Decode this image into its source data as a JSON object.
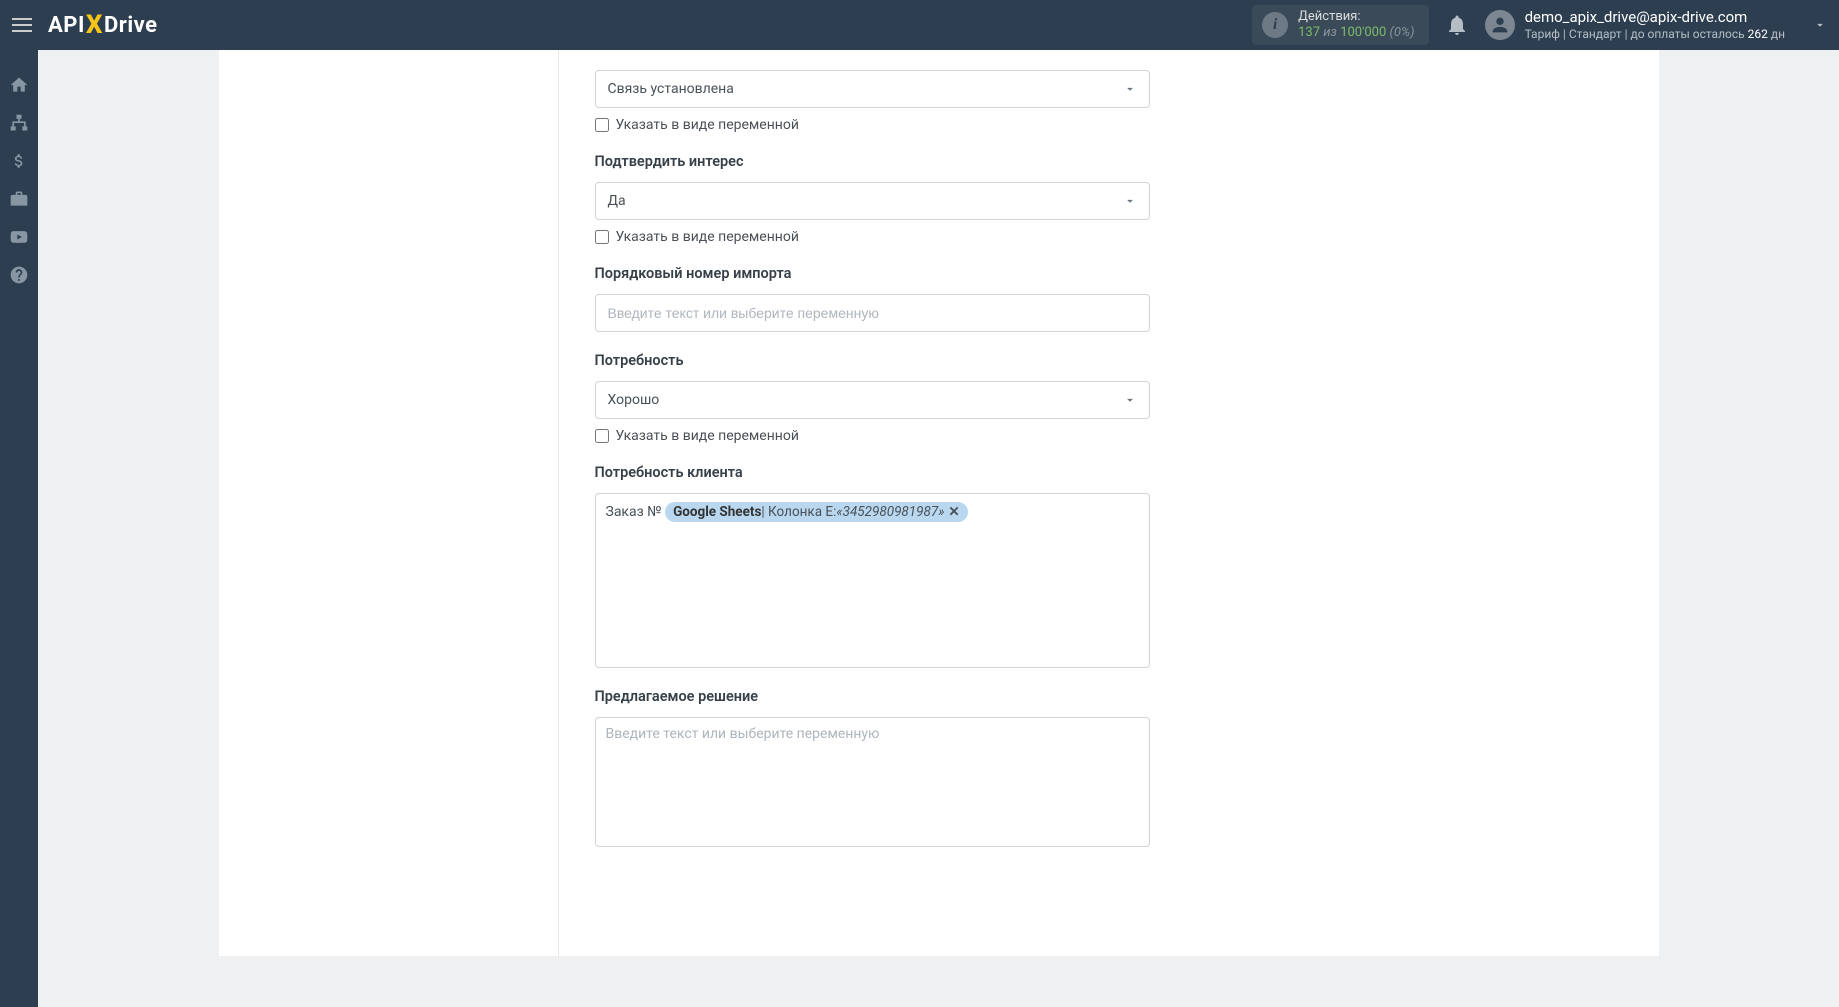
{
  "header": {
    "logo": {
      "api": "API",
      "x": "X",
      "drive": "Drive"
    },
    "actions": {
      "label": "Действия:",
      "count": "137",
      "of": "из",
      "limit": "100'000",
      "percent": "(0%)"
    },
    "user": {
      "email": "demo_apix_drive@apix-drive.com",
      "tariff_prefix": "Тариф | Стандарт | до оплаты осталось ",
      "days": "262",
      "days_suffix": " дн"
    }
  },
  "form": {
    "field1": {
      "value": "Связь установлена",
      "checkbox_label": "Указать в виде переменной"
    },
    "field2": {
      "label": "Подтвердить интерес",
      "value": "Да",
      "checkbox_label": "Указать в виде переменной"
    },
    "field3": {
      "label": "Порядковый номер импорта",
      "placeholder": "Введите текст или выберите переменную"
    },
    "field4": {
      "label": "Потребность",
      "value": "Хорошо",
      "checkbox_label": "Указать в виде переменной"
    },
    "field5": {
      "label": "Потребность клиента",
      "prefix": "Заказ № ",
      "tag": {
        "source": "Google Sheets",
        "sep": " | Колонка E: ",
        "value": "«3452980981987»"
      }
    },
    "field6": {
      "label": "Предлагаемое решение",
      "placeholder": "Введите текст или выберите переменную"
    }
  }
}
